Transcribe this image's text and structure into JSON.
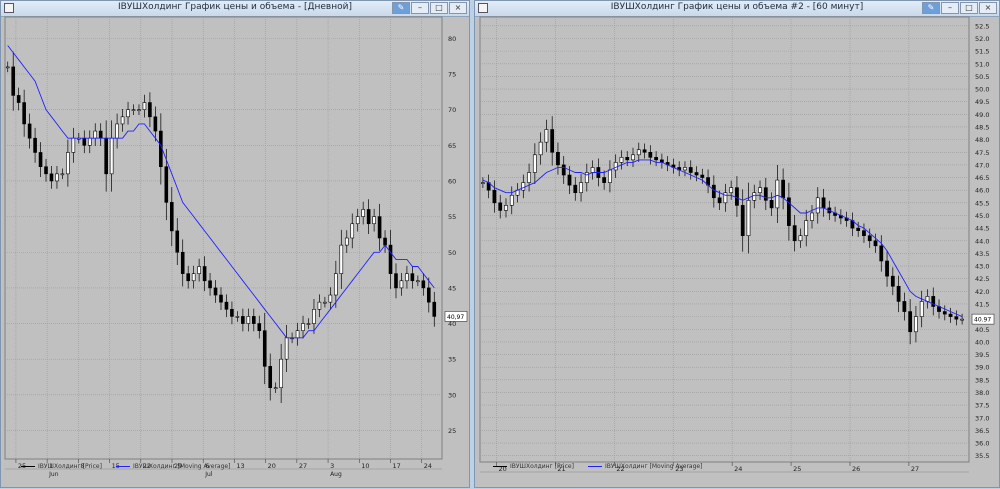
{
  "colors": {
    "grid": "#9a9a9a",
    "candle": "#000000",
    "ma": "#2020ff",
    "plot_bg": "#c0c0c0",
    "price_box": "#ffffff"
  },
  "windows": [
    {
      "title": "IВУШХолдинг График цены и объема - [Дневной]",
      "legend": [
        {
          "label": "IВУШХолдинг [Price]",
          "color": "#000000"
        },
        {
          "label": "IВУШХолдинг [Moving Average]",
          "color": "#2020ff"
        }
      ],
      "x_ticks": [
        "25",
        "1",
        "8",
        "15",
        "22",
        "29",
        "6",
        "13",
        "20",
        "27",
        "3",
        "10",
        "17",
        "24"
      ],
      "x_ticks_sub": [
        "",
        "Jun",
        "",
        "",
        "",
        "",
        "Jul",
        "",
        "",
        "",
        "Aug",
        "",
        "",
        ""
      ],
      "y_ticks": [
        "80",
        "75",
        "70",
        "65",
        "60",
        "55",
        "50",
        "45",
        "40",
        "35",
        "30",
        "25"
      ],
      "last_price": "40,97"
    },
    {
      "title": "IВУШХолдинг График цены и объема #2 - [60 минут]",
      "legend": [
        {
          "label": "IВУШХолдинг [Price]",
          "color": "#000000"
        },
        {
          "label": "IВУШХолдинг [Moving Average]",
          "color": "#2020ff"
        }
      ],
      "x_ticks": [
        "20",
        "21",
        "22",
        "23",
        "24",
        "25",
        "26",
        "27"
      ],
      "y_ticks": [
        "52.5",
        "52.0",
        "51.5",
        "51.0",
        "50.5",
        "50.0",
        "49.5",
        "49.0",
        "48.5",
        "48.0",
        "47.5",
        "47.0",
        "46.5",
        "46.0",
        "45.5",
        "45.0",
        "44.5",
        "44.0",
        "43.5",
        "43.0",
        "42.5",
        "42.0",
        "41.5",
        "41.0",
        "40.5",
        "40.0",
        "39.5",
        "39.0",
        "38.5",
        "38.0",
        "37.5",
        "37.0",
        "36.5",
        "36.0",
        "35.5"
      ],
      "last_price": "40.97"
    }
  ],
  "chart_data": [
    {
      "type": "candlestick",
      "title": "IВУШХолдинг График цены и объема - [Дневной]",
      "series": [
        {
          "name": "IВУШХолдинг [Price]",
          "close": [
            76,
            72,
            71,
            68,
            66,
            64,
            62,
            61,
            60,
            61,
            61,
            64,
            66,
            66,
            65,
            66,
            67,
            66,
            61,
            66,
            68,
            69,
            70,
            70,
            70,
            71,
            69,
            67,
            62,
            57,
            53,
            50,
            47,
            46,
            47,
            48,
            46,
            45,
            44,
            43,
            42,
            41,
            41,
            40,
            41,
            40,
            39,
            34,
            31,
            31,
            35,
            38,
            38,
            39,
            40,
            40,
            42,
            43,
            43,
            44,
            47,
            51,
            52,
            54,
            55,
            56,
            54,
            55,
            52,
            51,
            47,
            45,
            46,
            47,
            46,
            46,
            45,
            43,
            41
          ]
        },
        {
          "name": "IВУШХолдинг [Moving Average]",
          "values": [
            79,
            78,
            77,
            76,
            75,
            74,
            72,
            70,
            69,
            68,
            67,
            66,
            66,
            66,
            66,
            66,
            66,
            66,
            66,
            66,
            66,
            66,
            67,
            67,
            68,
            68,
            67,
            66,
            65,
            63,
            61,
            59,
            57,
            56,
            55,
            54,
            53,
            52,
            51,
            50,
            49,
            48,
            47,
            46,
            45,
            44,
            43,
            42,
            41,
            40,
            39,
            38,
            38,
            38,
            38,
            39,
            39,
            40,
            41,
            42,
            43,
            44,
            45,
            46,
            47,
            48,
            49,
            50,
            50,
            51,
            50,
            49,
            49,
            49,
            48,
            48,
            47,
            46,
            45
          ]
        }
      ],
      "ylim": [
        21,
        83
      ],
      "y_ticks": [
        80,
        75,
        70,
        65,
        60,
        55,
        50,
        45,
        40,
        35,
        30,
        25
      ],
      "x_ticks": [
        "25",
        "1",
        "8",
        "15",
        "22",
        "29",
        "6",
        "13",
        "20",
        "27",
        "3",
        "10",
        "17",
        "24"
      ]
    },
    {
      "type": "candlestick",
      "title": "IВУШХолдинг График цены и объема #2 - [60 минут]",
      "series": [
        {
          "name": "IВУШХолдинг [Price]",
          "close": [
            46.3,
            46.0,
            45.5,
            45.2,
            45.4,
            45.8,
            46.0,
            46.3,
            46.7,
            47.4,
            47.9,
            48.4,
            47.5,
            47.0,
            46.6,
            46.2,
            45.9,
            46.3,
            46.7,
            46.9,
            46.5,
            46.3,
            46.8,
            47.1,
            47.3,
            47.2,
            47.4,
            47.6,
            47.5,
            47.3,
            47.2,
            47.1,
            47.0,
            46.9,
            46.8,
            46.9,
            46.7,
            46.6,
            46.5,
            46.2,
            45.7,
            45.5,
            45.9,
            46.1,
            45.4,
            44.2,
            45.6,
            45.9,
            46.1,
            45.6,
            45.3,
            46.4,
            45.7,
            44.6,
            44.0,
            44.2,
            44.8,
            45.1,
            45.7,
            45.3,
            45.1,
            45.0,
            44.9,
            44.8,
            44.5,
            44.4,
            44.2,
            44.0,
            43.8,
            43.2,
            42.6,
            42.2,
            41.6,
            41.2,
            40.4,
            41.0,
            41.6,
            41.8,
            41.4,
            41.2,
            41.1,
            41.0,
            40.9,
            40.9
          ]
        },
        {
          "name": "IВУШХолдинг [Moving Average]",
          "values": [
            46.4,
            46.3,
            46.1,
            46.0,
            45.9,
            45.9,
            46.0,
            46.1,
            46.2,
            46.3,
            46.5,
            46.7,
            46.8,
            46.9,
            46.9,
            46.8,
            46.7,
            46.7,
            46.6,
            46.7,
            46.7,
            46.7,
            46.8,
            46.9,
            47.0,
            47.1,
            47.1,
            47.2,
            47.2,
            47.2,
            47.1,
            47.1,
            47.0,
            46.9,
            46.8,
            46.7,
            46.6,
            46.5,
            46.4,
            46.2,
            46.0,
            45.9,
            45.8,
            45.8,
            45.7,
            45.6,
            45.7,
            45.8,
            45.8,
            45.7,
            45.7,
            45.8,
            45.7,
            45.5,
            45.3,
            45.1,
            45.1,
            45.2,
            45.3,
            45.3,
            45.2,
            45.1,
            45.0,
            44.9,
            44.8,
            44.6,
            44.5,
            44.3,
            44.1,
            43.9,
            43.6,
            43.2,
            42.8,
            42.4,
            42.0,
            41.8,
            41.7,
            41.6,
            41.5,
            41.4,
            41.3,
            41.2,
            41.1,
            41.0
          ]
        }
      ],
      "ylim": [
        35.25,
        52.85
      ],
      "y_ticks": [
        52.5,
        52.0,
        51.5,
        51.0,
        50.5,
        50.0,
        49.5,
        49.0,
        48.5,
        48.0,
        47.5,
        47.0,
        46.5,
        46.0,
        45.5,
        45.0,
        44.5,
        44.0,
        43.5,
        43.0,
        42.5,
        42.0,
        41.5,
        41.0,
        40.5,
        40.0,
        39.5,
        39.0,
        38.5,
        38.0,
        37.5,
        37.0,
        36.5,
        36.0,
        35.5
      ],
      "x_ticks": [
        "20",
        "21",
        "22",
        "23",
        "24",
        "25",
        "26",
        "27"
      ]
    }
  ]
}
